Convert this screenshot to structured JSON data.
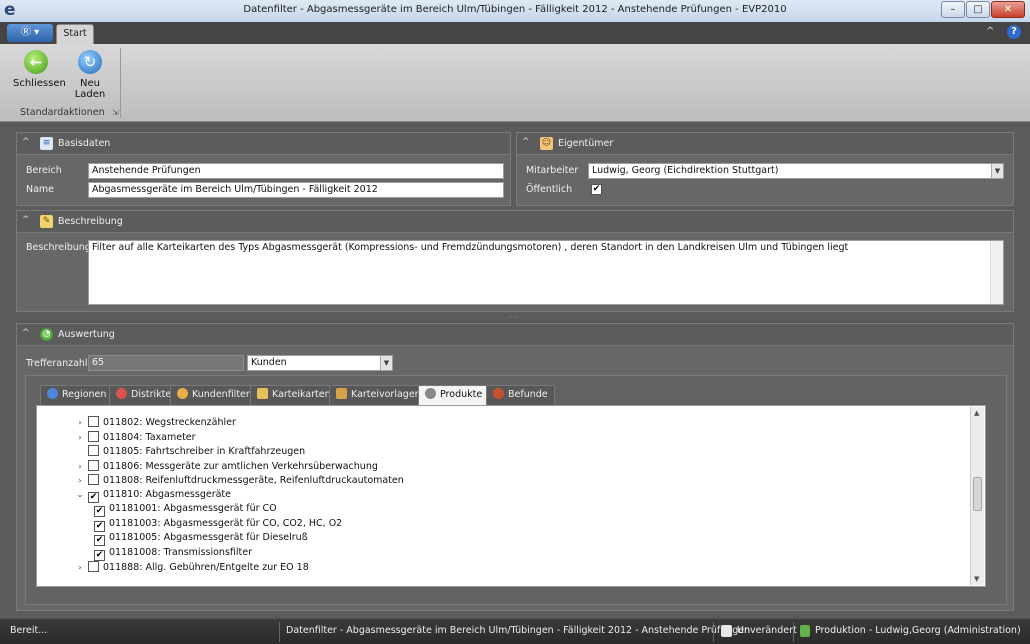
{
  "window": {
    "title": "Datenfilter - Abgasmessgeräte im Bereich Ulm/Tübingen - Fälligkeit 2012 - Anstehende Prüfungen - EVP2010",
    "app_icon": "e-logo-icon",
    "minimize": "–",
    "maximize": "□",
    "close": "✕"
  },
  "ribbon": {
    "app_menu_label": "Ⓡ ▾",
    "tabs": [
      "Start"
    ],
    "collapse_glyph": "^",
    "help_glyph": "?",
    "buttons": [
      {
        "label": "Schliessen",
        "icon": "back-arrow-icon",
        "glyph": "←"
      },
      {
        "label": "Neu Laden",
        "icon": "reload-icon",
        "glyph": "↻"
      }
    ],
    "group_label": "Standardaktionen",
    "group_launcher": "⇲"
  },
  "basisdaten": {
    "title": "Basisdaten",
    "bereich_label": "Bereich",
    "bereich_value": "Anstehende Prüfungen",
    "name_label": "Name",
    "name_value": "Abgasmessgeräte im Bereich Ulm/Tübingen - Fälligkeit 2012"
  },
  "eigentuemer": {
    "title": "Eigentümer",
    "mitarbeiter_label": "Mitarbeiter",
    "mitarbeiter_value": "Ludwig, Georg (Eichdirektion Stuttgart)",
    "oeffentlich_label": "Öffentlich",
    "oeffentlich_checked": "✔"
  },
  "beschreibung": {
    "title": "Beschreibung",
    "label": "Beschreibung",
    "text": "Filter auf alle Karteikarten des Typs Abgasmessgerät (Kompressions- und Fremdzündungsmotoren) , deren Standort in den Landkreisen Ulm und Tübingen liegt"
  },
  "auswertung": {
    "title": "Auswertung",
    "trefferanzahl_label": "Trefferanzahl",
    "trefferanzahl_value": "65",
    "scope_value": "Kunden",
    "tabs": [
      "Regionen",
      "Distrikte",
      "Kundenfilter",
      "Karteikarten",
      "Karteivorlagen",
      "Produkte",
      "Befunde"
    ],
    "active_tab": "Produkte",
    "tree": [
      {
        "indent": 0,
        "expander": "›",
        "checked": "",
        "label": "011802: Wegstreckenzähler"
      },
      {
        "indent": 0,
        "expander": "›",
        "checked": "",
        "label": "011804: Taxameter"
      },
      {
        "indent": 0,
        "expander": "",
        "checked": "",
        "label": "011805: Fahrtschreiber in Kraftfahrzeugen"
      },
      {
        "indent": 0,
        "expander": "›",
        "checked": "",
        "label": "011806: Messgeräte zur amtlichen Verkehrsüberwachung"
      },
      {
        "indent": 0,
        "expander": "›",
        "checked": "",
        "label": "011808: Reifenluftdruckmessgeräte, Reifenluftdruckautomaten"
      },
      {
        "indent": 0,
        "expander": "⌄",
        "checked": "✔",
        "label": "011810: Abgasmessgeräte"
      },
      {
        "indent": 1,
        "expander": "",
        "checked": "✔",
        "label": "01181001: Abgasmessgerät für CO"
      },
      {
        "indent": 1,
        "expander": "",
        "checked": "✔",
        "label": "01181003: Abgasmessgerät für CO, CO2, HC, O2"
      },
      {
        "indent": 1,
        "expander": "",
        "checked": "✔",
        "label": "01181005: Abgasmessgerät für Dieselruß"
      },
      {
        "indent": 1,
        "expander": "",
        "checked": "✔",
        "label": "01181008: Transmissionsfilter"
      },
      {
        "indent": 0,
        "expander": "›",
        "checked": "",
        "label": "011888: Allg. Gebühren/Entgelte zur EO 18"
      }
    ]
  },
  "statusbar": {
    "left": "Bereit...",
    "center": "Datenfilter - Abgasmessgeräte im Bereich Ulm/Tübingen - Fälligkeit 2012 - Anstehende Prüfungen",
    "state": "Unverändert",
    "environment": "Produktion - Ludwig,Georg (Administration)"
  },
  "colors": {
    "background": "#5b5b5b",
    "panel": "#676767",
    "accent": "#2f63aa",
    "ribbon": "#d0d0d0"
  }
}
